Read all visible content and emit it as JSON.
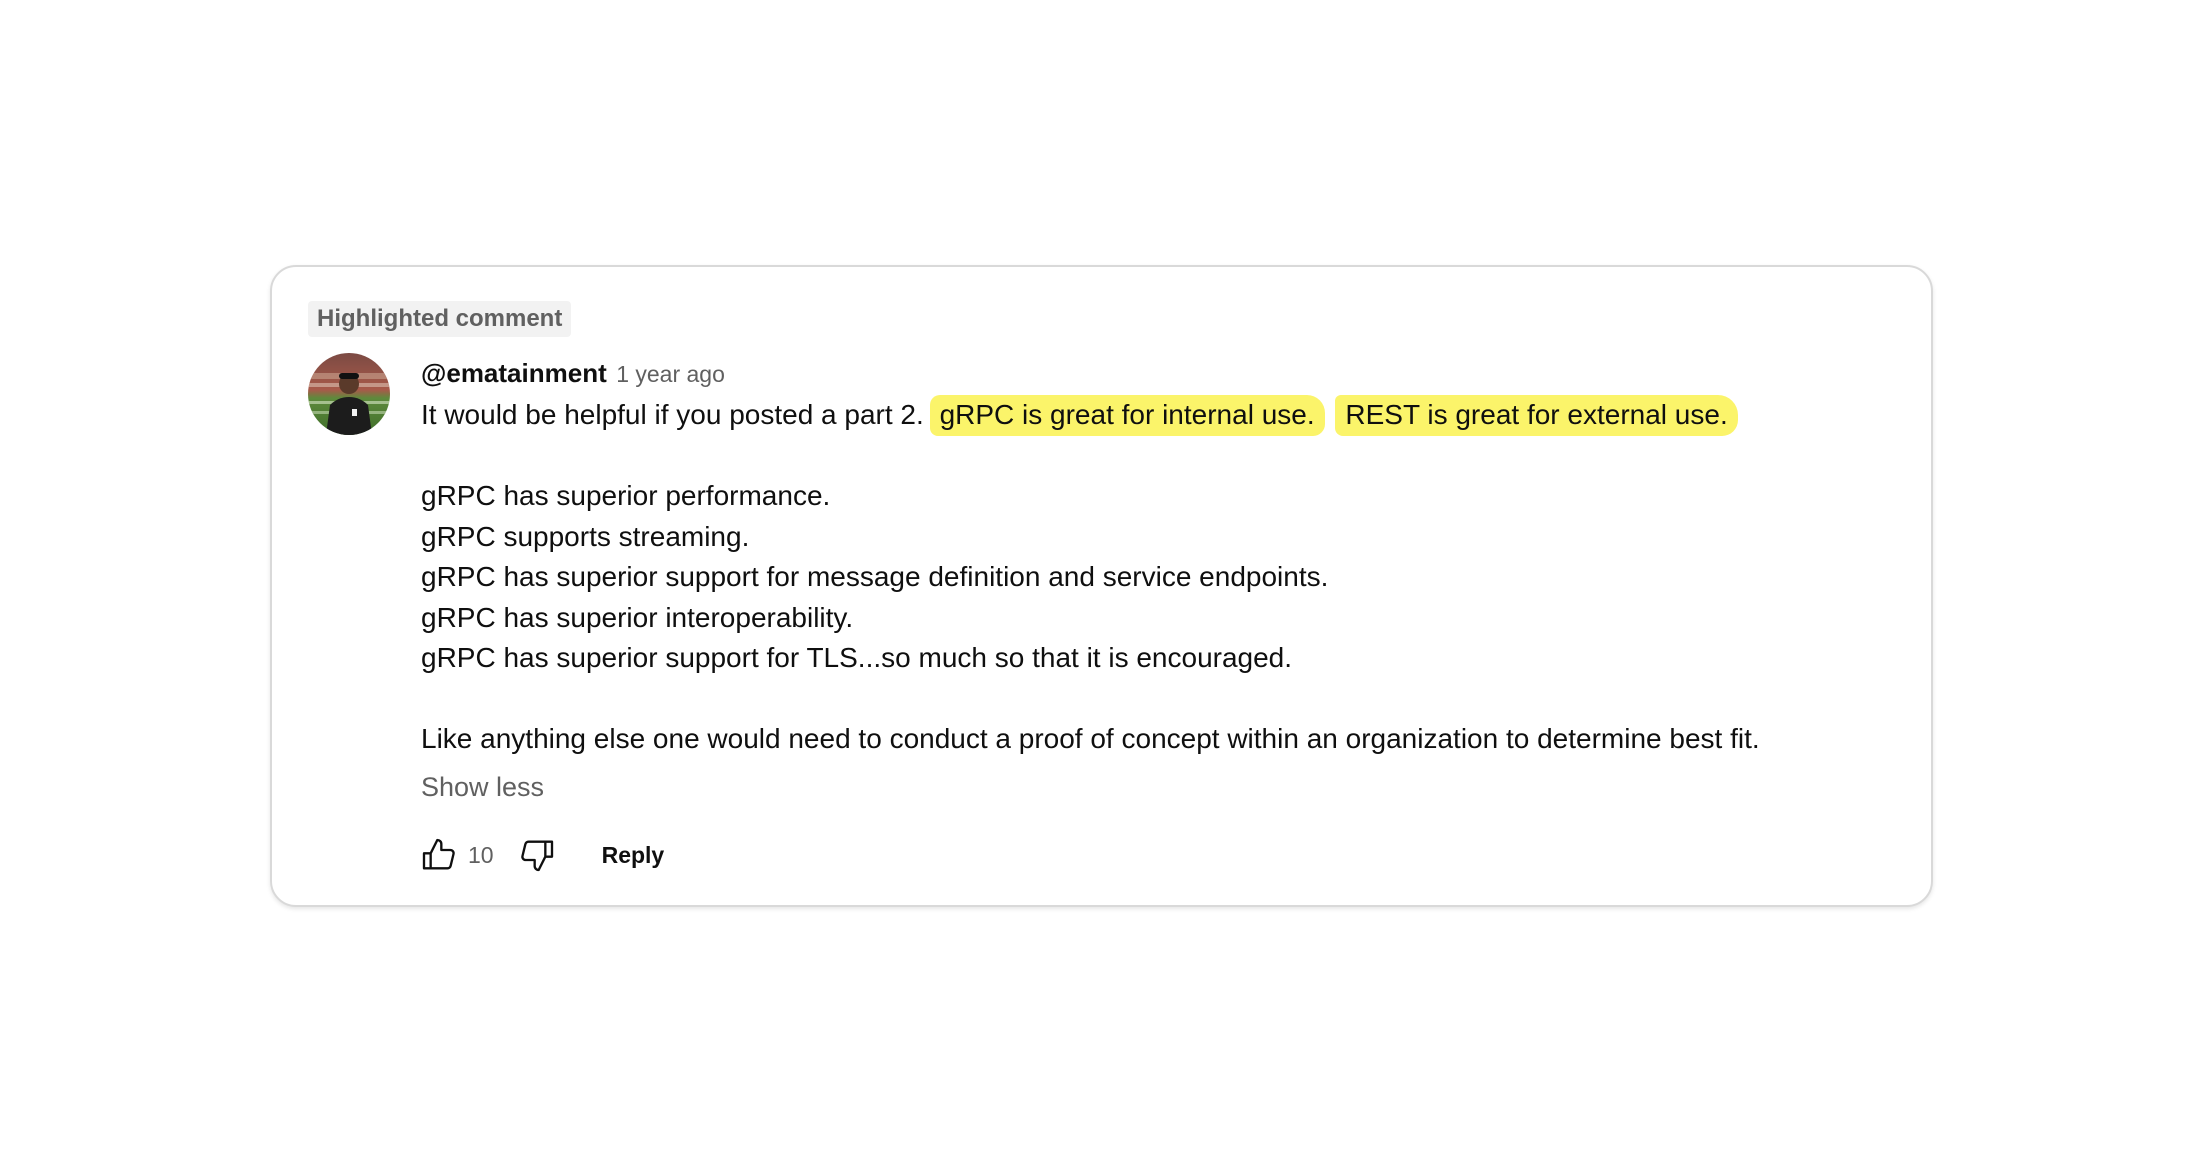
{
  "comment": {
    "badge": "Highlighted comment",
    "author": "@ematainment",
    "time": "1 year ago",
    "line1_plain": "It would be helpful if you posted a part 2.",
    "line1_highlight_a": "gRPC is great for internal use.",
    "line1_highlight_b": "REST is great for external use.",
    "points": [
      "gRPC has superior performance.",
      "gRPC supports streaming.",
      "gRPC has superior support for message definition and service endpoints.",
      "gRPC has superior interoperability.",
      "gRPC has superior support for TLS...so much so that it is encouraged."
    ],
    "closing": "Like anything else one would need to conduct a proof of concept within an organization to determine best fit.",
    "show_less": "Show less",
    "like_count": "10",
    "reply_label": "Reply",
    "highlight_color": "#fbf46a",
    "icons": {
      "like": "thumbs-up-icon",
      "dislike": "thumbs-down-icon"
    }
  }
}
